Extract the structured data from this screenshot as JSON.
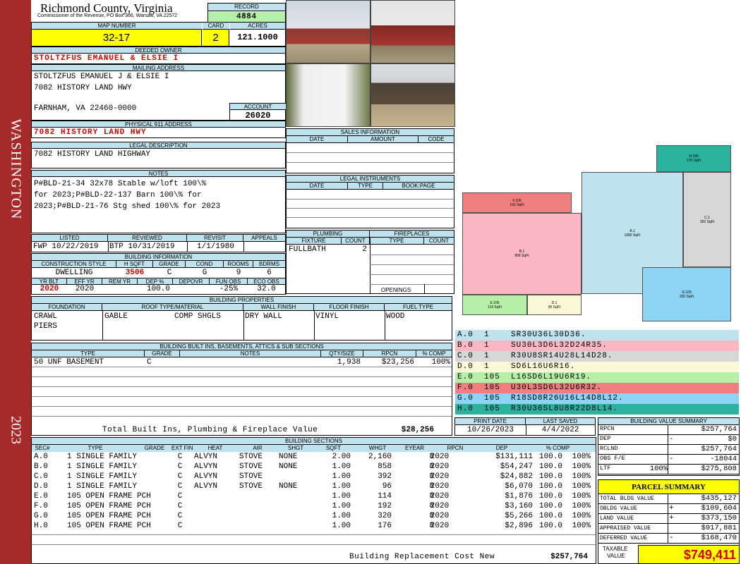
{
  "county": {
    "title": "Richmond County, Virginia",
    "subtitle": "Commissioner of the Revenue, PO Box 366, Warsaw, VA 22572"
  },
  "record": {
    "label": "RECORD",
    "value": "4884"
  },
  "map": {
    "label": "MAP NUMBER",
    "value": "32-17"
  },
  "card": {
    "label": "CARD",
    "value": "2"
  },
  "acres": {
    "label": "ACRES",
    "value": "121.1000"
  },
  "owner": {
    "label": "DEEDED OWNER",
    "value": "STOLTZFUS EMANUEL & ELSIE I"
  },
  "mailing": {
    "label": "MAILING ADDRESS",
    "line1": "STOLTZFUS EMANUEL J & ELSIE I",
    "line2": "7082 HISTORY LAND HWY",
    "line3": "FARNHAM, VA 22460-0000"
  },
  "account": {
    "label": "ACCOUNT",
    "value": "26020"
  },
  "physical": {
    "label": "PHYSICAL 911 ADDRESS",
    "value": "7082 HISTORY LAND HWY"
  },
  "legal": {
    "label": "LEGAL DESCRIPTION",
    "value": "7082 HISTORY LAND HIGHWAY"
  },
  "notes": {
    "label": "NOTES",
    "line1": "P#BLD-21-34 32x78 Stable w/loft 100\\%",
    "line2": "for 2023;P#BLD-22-137 Barn 100\\% for",
    "line3": "2023;P#BLD-21-76 Stg shed 100\\% for 2023"
  },
  "side": {
    "district": "WASHINGTON",
    "year": "2023"
  },
  "sales": {
    "label": "SALES INFORMATION",
    "cols": [
      "DATE",
      "AMOUNT",
      "CODE"
    ]
  },
  "instruments": {
    "label": "LEGAL INSTRUMENTS",
    "cols": [
      "DATE",
      "TYPE",
      "BOOK:PAGE"
    ]
  },
  "plumbing": {
    "label": "PLUMBING",
    "cols": [
      "FIXTURE",
      "COUNT"
    ],
    "fixture": "FULLBATH",
    "count": "2"
  },
  "fireplaces": {
    "label": "FIREPLACES",
    "cols": [
      "TYPE",
      "COUNT"
    ],
    "openings": "OPENINGS"
  },
  "review": {
    "listed_l": "LISTED",
    "listed": "FWP 10/22/2019",
    "reviewed_l": "REVIEWED",
    "reviewed": "BTP 10/31/2019",
    "revisit_l": "REVISIT",
    "revisit": "1/1/1980",
    "appeals_l": "APPEALS"
  },
  "bldg": {
    "label": "BUILDING INFORMATION",
    "h": [
      "CONSTRUCTION STYLE",
      "H SQFT",
      "GRADE",
      "COND",
      "ROOMS",
      "BDRMS"
    ],
    "v": [
      "DWELLING",
      "3506",
      "C",
      "G",
      "9",
      "6"
    ],
    "h2": [
      "YR BLT",
      "EFF YR",
      "REM YR",
      "DEP %",
      "DEPOVR",
      "FUN OBS",
      "ECO OBS"
    ],
    "v2": [
      "2020",
      "2020",
      "",
      "100.0",
      "",
      "-25%",
      "32.0"
    ]
  },
  "props": {
    "label": "BUILDING PROPERTIES",
    "h": [
      "FOUNDATION",
      "ROOF TYPE/MATERIAL",
      "WALL FINISH",
      "FLOOR FINISH",
      "FUEL TYPE"
    ],
    "foundation1": "CRAWL",
    "foundation2": "PIERS",
    "roof1": "GABLE",
    "roof2": "COMP SHGLS",
    "wall": "DRY WALL",
    "floor": "VINYL",
    "fuel": "WOOD"
  },
  "builtins": {
    "label": "BUILDING BUILT INS, BASEMENTS, ATTICS & SUB SECTIONS",
    "h": [
      "TYPE",
      "GRADE",
      "NOTES",
      "QTY/SIZE",
      "RPCN",
      "% COMP"
    ],
    "row": [
      "50 UNF BASEMENT",
      "C",
      "",
      "1,938",
      "$23,256",
      "100%"
    ],
    "total_label": "Total Built Ins, Plumbing & Fireplace Value",
    "total": "$28,256"
  },
  "print": {
    "label": "PRINT DATE",
    "value": "10/26/2023",
    "saved_label": "LAST SAVED",
    "saved": "4/4/2022"
  },
  "sections": {
    "label": "BUILDING SECTIONS",
    "h": [
      "SEC#",
      "TYPE",
      "GRADE",
      "EXT FIN",
      "HEAT",
      "AIR",
      "SHGT",
      "SQFT",
      "WHGT",
      "EYEAR",
      "RPCN",
      "DEP",
      "% COMP"
    ],
    "rows": [
      [
        "A.0",
        "1 SINGLE FAMILY",
        "C",
        "ALVYN",
        "STOVE",
        "NONE",
        "2.00",
        "2,160",
        "8",
        "2020",
        "$131,111",
        "100.0",
        "100%"
      ],
      [
        "B.0",
        "1 SINGLE FAMILY",
        "C",
        "ALVYN",
        "STOVE",
        "NONE",
        "1.00",
        "858",
        "8",
        "2020",
        "$54,247",
        "100.0",
        "100%"
      ],
      [
        "C.0",
        "1 SINGLE FAMILY",
        "C",
        "ALVYN",
        "STOVE",
        "",
        "1.00",
        "392",
        "8",
        "2020",
        "$24,882",
        "100.0",
        "100%"
      ],
      [
        "D.0",
        "1 SINGLE FAMILY",
        "C",
        "ALVYN",
        "STOVE",
        "NONE",
        "1.00",
        "96",
        "8",
        "2020",
        "$6,070",
        "100.0",
        "100%"
      ],
      [
        "E.0",
        "105 OPEN FRAME PCH",
        "C",
        "",
        "",
        "",
        "1.00",
        "114",
        "8",
        "2020",
        "$1,876",
        "100.0",
        "100%"
      ],
      [
        "F.0",
        "105 OPEN FRAME PCH",
        "C",
        "",
        "",
        "",
        "1.00",
        "192",
        "8",
        "2020",
        "$3,160",
        "100.0",
        "100%"
      ],
      [
        "G.0",
        "105 OPEN FRAME PCH",
        "C",
        "",
        "",
        "",
        "1.00",
        "320",
        "8",
        "2020",
        "$5,266",
        "100.0",
        "100%"
      ],
      [
        "H.0",
        "105 OPEN FRAME PCH",
        "C",
        "",
        "",
        "",
        "1.00",
        "176",
        "8",
        "2020",
        "$2,896",
        "100.0",
        "100%"
      ]
    ],
    "total_label": "Building Replacement Cost New",
    "total": "$257,764"
  },
  "areas": [
    {
      "text": "A.0  1    SR30U36L30D36.",
      "color": "#bfe3ee"
    },
    {
      "text": "B.0  1    SU30L3D6L32D24R35.",
      "color": "#fbb8c3"
    },
    {
      "text": "C.0  1    R30U8SR14U28L14D28.",
      "color": "#d7d7d7"
    },
    {
      "text": "D.0  1    SD6L16U6R16.",
      "color": "#fbf8d8"
    },
    {
      "text": "E.0  105  L16SD6L19U6R19.",
      "color": "#b6f0a8"
    },
    {
      "text": "F.0  105  U30L3SD6L32U6R32.",
      "color": "#ef7f7f"
    },
    {
      "text": "G.0  105  R18SD8R26U16L14D8L12.",
      "color": "#8cd3f4"
    },
    {
      "text": "H.0  105  R30U36SL8U8R22D8L14.",
      "color": "#2bb3a0"
    }
  ],
  "sketch": {
    "a": "A.1",
    "a_sq": "1080 SqFt",
    "b": "B.1",
    "b_sq": "858 SqFt",
    "c": "C.1",
    "c_sq": "392 SqFt",
    "d": "D.1",
    "d_sq": "96 SqFt",
    "e": "E.105",
    "e_sq": "114 SqFt",
    "f": "F.105",
    "f_sq": "192 SqFt",
    "g": "G.105",
    "g_sq": "320 SqFt",
    "h": "H.105",
    "h_sq": "176 SqFt"
  },
  "bvs": {
    "label": "BUILDING VALUE SUMMARY",
    "rows": [
      [
        "RPCN",
        "",
        "",
        "$257,764"
      ],
      [
        "DEP",
        "",
        "-",
        "$0"
      ],
      [
        "RCLND",
        "",
        "",
        "$257,764"
      ],
      [
        "OBS F/E",
        "",
        "-",
        "-18044"
      ],
      [
        "LTF",
        "100%",
        "",
        "$275,808"
      ]
    ]
  },
  "parcel": {
    "label": "PARCEL SUMMARY",
    "rows": [
      [
        "TOTAL BLDG VALUE",
        "",
        "$435,127"
      ],
      [
        "OBLDG VALUE",
        "+",
        "$109,604"
      ],
      [
        "LAND VALUE",
        "+",
        "$373,150"
      ],
      [
        "APPRAISED VALUE",
        "",
        "$917,881"
      ],
      [
        "DEFERRED VALUE",
        "-",
        "$168,470"
      ]
    ],
    "taxable_label1": "TAXABLE",
    "taxable_label2": "VALUE",
    "taxable": "$749,411"
  }
}
